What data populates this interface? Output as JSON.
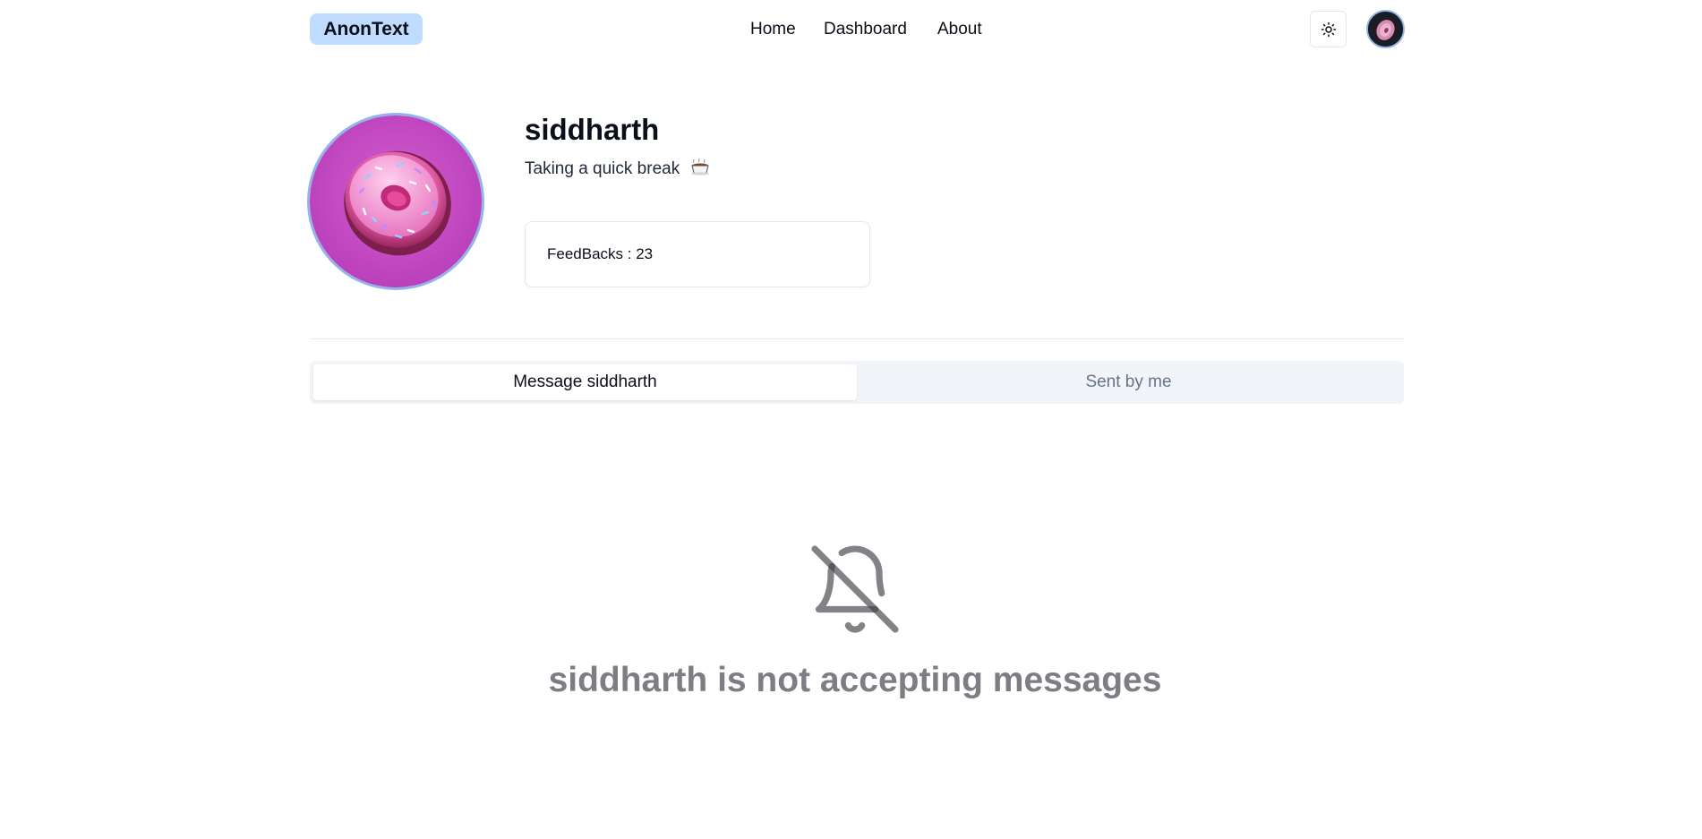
{
  "header": {
    "brand": "AnonText",
    "nav": [
      {
        "label": "Home"
      },
      {
        "label": "Dashboard"
      },
      {
        "label": "About"
      }
    ],
    "theme_toggle_icon": "sun-icon",
    "user_avatar_icon": "donut-avatar"
  },
  "profile": {
    "name": "siddharth",
    "status": "Taking a quick break",
    "status_emoji_icon": "coffee-cup-icon",
    "feedbacks_label": "FeedBacks : 23"
  },
  "tabs": [
    {
      "label": "Message siddharth",
      "active": true
    },
    {
      "label": "Sent by me",
      "active": false
    }
  ],
  "empty_state": {
    "icon": "bell-off-icon",
    "message": "siddharth is not accepting messages"
  },
  "colors": {
    "brand_bg": "#bfdbfe",
    "avatar_ring": "#93b4e8",
    "tabs_bg": "#f1f5f9",
    "muted_text": "#7c7e84"
  }
}
